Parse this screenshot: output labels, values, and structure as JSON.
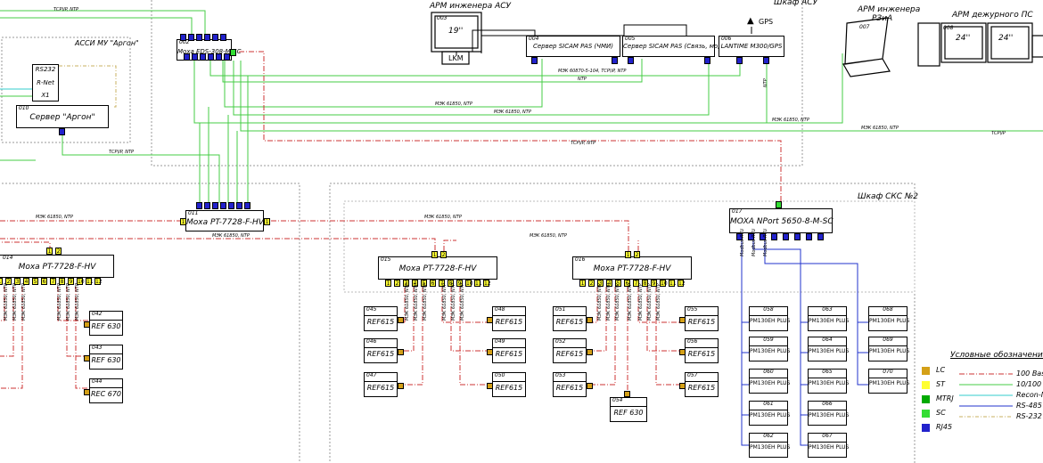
{
  "colors": {
    "lc": "#d4a017",
    "st": "#ffff33",
    "mtrj": "#00aa00",
    "sc": "#33dd33",
    "rj45": "#2222cc",
    "ethernet": "#cc3333",
    "fiber": "#44cc44",
    "rs485": "#2233cc",
    "rs232": "#c8b060",
    "recon": "#33cccc"
  },
  "areas": {
    "asu_cabinet": "Шкаф АСУ",
    "sks2": "Шкаф СКС №2",
    "assi": "АССИ МУ \"Аргон\""
  },
  "workstations": {
    "asu_engineer": "АРМ инженера АСУ",
    "rza_engineer_l1": "АРМ инженера",
    "rza_engineer_l2": "РЗиА",
    "duty_ps": "АРМ дежурного ПС",
    "gps": "GPS"
  },
  "devices": {
    "d002": {
      "num": "002",
      "label": "Moxa EDS-308-M-SC"
    },
    "d003": {
      "num": "003",
      "label": "19''",
      "kvm": "LKM"
    },
    "d004": {
      "num": "004",
      "label": "Сервер SICAM PAS (ЧМИ)"
    },
    "d005": {
      "num": "005",
      "label": "Сервер SICAM PAS (Связь, модуль)"
    },
    "d006": {
      "num": "006",
      "label": "LANTIME M300/GPS"
    },
    "d007": {
      "num": "007"
    },
    "d008": {
      "num": "008",
      "label1": "24''",
      "label2": "24''"
    },
    "d010": {
      "num": "010",
      "label": "Сервер \"Аргон\"",
      "rs232": "RS232",
      "rnet": "R-Net",
      "x1": "X1"
    },
    "d011": {
      "num": "011",
      "label": "Moxa PT-7728-F-HV"
    },
    "d014": {
      "num": "014",
      "label": "Moxa PT-7728-F-HV"
    },
    "d015": {
      "num": "015",
      "label": "Moxa PT-7728-F-HV"
    },
    "d016": {
      "num": "016",
      "label": "Moxa PT-7728-F-HV"
    },
    "d017": {
      "num": "017",
      "label": "MOXA NPort 5650-8-M-SC"
    }
  },
  "relays": [
    {
      "num": "042",
      "label": "REF 630"
    },
    {
      "num": "043",
      "label": "REF 630"
    },
    {
      "num": "044",
      "label": "REC 670"
    },
    {
      "num": "045",
      "label": "REF615"
    },
    {
      "num": "046",
      "label": "REF615"
    },
    {
      "num": "047",
      "label": "REF615"
    },
    {
      "num": "048",
      "label": "REF615"
    },
    {
      "num": "049",
      "label": "REF615"
    },
    {
      "num": "050",
      "label": "REF615"
    },
    {
      "num": "051",
      "label": "REF615"
    },
    {
      "num": "052",
      "label": "REF615"
    },
    {
      "num": "053",
      "label": "REF615"
    },
    {
      "num": "054",
      "label": "REF 630"
    },
    {
      "num": "055",
      "label": "REF615"
    },
    {
      "num": "056",
      "label": "REF615"
    },
    {
      "num": "057",
      "label": "REF615"
    }
  ],
  "meters": [
    {
      "num": "058",
      "label": "PM130EH PLUS"
    },
    {
      "num": "059",
      "label": "PM130EH PLUS"
    },
    {
      "num": "060",
      "label": "PM130EH PLUS"
    },
    {
      "num": "061",
      "label": "PM130EH PLUS"
    },
    {
      "num": "062",
      "label": "PM130EH PLUS"
    },
    {
      "num": "063",
      "label": "PM130EH PLUS"
    },
    {
      "num": "064",
      "label": "PM130EH PLUS"
    },
    {
      "num": "065",
      "label": "PM130EH PLUS"
    },
    {
      "num": "066",
      "label": "PM130EH PLUS"
    },
    {
      "num": "067",
      "label": "PM130EH PLUS"
    },
    {
      "num": "068",
      "label": "PM130EH PLUS"
    },
    {
      "num": "069",
      "label": "PM130EH PLUS"
    },
    {
      "num": "070",
      "label": "PM130EH PLUS"
    }
  ],
  "wire_labels": {
    "tcpip_ntp": "ТСР\\IP, NTP",
    "mek_ntp": "МЭК 61850, NTP",
    "mek104": "МЭК 60870-5-104, ТСР\\IP, NTP",
    "ntp": "NTP",
    "tcpip": "ТСР\\IP",
    "modbus": "Modbus RTU"
  },
  "legend": {
    "title": "Условные обозначения:",
    "connectors": [
      {
        "key": "lc",
        "label": "LC"
      },
      {
        "key": "st",
        "label": "ST"
      },
      {
        "key": "mtrj",
        "label": "MTRJ"
      },
      {
        "key": "sc",
        "label": "SC"
      },
      {
        "key": "rj45",
        "label": "RJ45"
      }
    ],
    "lines": [
      {
        "key": "ethernet",
        "label": "100 Base"
      },
      {
        "key": "fiber",
        "label": "10/100 Ba"
      },
      {
        "key": "recon",
        "label": "Recon-N"
      },
      {
        "key": "rs485",
        "label": "RS-485"
      },
      {
        "key": "rs232",
        "label": "RS-232"
      }
    ]
  }
}
